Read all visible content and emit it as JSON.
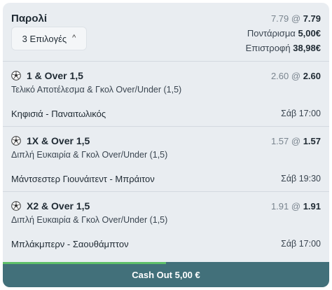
{
  "parlay": {
    "title": "Παρολί",
    "selections_button": "3 Επιλογές",
    "odds_old": "7.79",
    "odds_sep": " @ ",
    "odds_new": "7.79",
    "stake_label": "Ποντάρισμα",
    "stake_value": "5,00€",
    "return_label": "Επιστροφή",
    "return_value": "38,98€"
  },
  "selections": [
    {
      "title": "1 & Over 1,5",
      "odds_old": "2.60",
      "odds_new": "2.60",
      "market": "Τελικό Αποτέλεσμα & Γκολ Over/Under (1,5)",
      "teams": "Κηφισιά - Παναιτωλικός",
      "time": "Σάβ 17:00"
    },
    {
      "title": "1X & Over 1,5",
      "odds_old": "1.57",
      "odds_new": "1.57",
      "market": "Διπλή Ευκαιρία & Γκολ Over/Under (1,5)",
      "teams": "Μάντσεστερ Γιουνάιτεντ - Μπράιτον",
      "time": "Σάβ 19:30"
    },
    {
      "title": "X2 & Over 1,5",
      "odds_old": "1.91",
      "odds_new": "1.91",
      "market": "Διπλή Ευκαιρία & Γκολ Over/Under (1,5)",
      "teams": "Μπλάκμπερν - Σαουθάμπτον",
      "time": "Σάβ 17:00"
    }
  ],
  "cashout": {
    "label": "Cash Out 5,00 €",
    "progress": 0.5
  },
  "colors": {
    "card_bg": "#e9edf1",
    "cashout_bg": "#42707a",
    "progress": "#5fbf6a"
  },
  "icons": {
    "sport": "soccer-ball-icon",
    "expand": "chevron-up-icon"
  }
}
